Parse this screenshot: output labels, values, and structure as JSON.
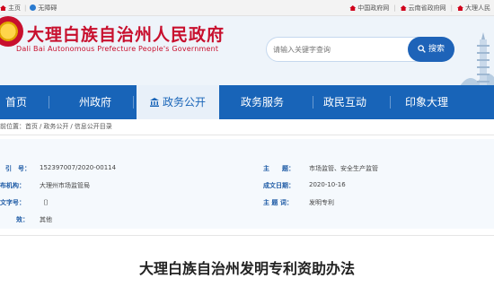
{
  "topbar": {
    "home_text": "主页",
    "accessibility_text": "无障碍",
    "links": [
      "中国政府网",
      "云南省政府网",
      "大理人民"
    ]
  },
  "header": {
    "site_title": "大理白族自治州人民政府",
    "site_subtitle": "Dali Bai Autonomous Prefecture People's Government",
    "search_placeholder": "请输入关键字查询",
    "search_button": "搜索"
  },
  "nav": {
    "items": [
      "首页",
      "州政府",
      "政务公开",
      "政务服务",
      "政民互动",
      "印象大理"
    ],
    "active_index": 2
  },
  "breadcrumb": {
    "prefix": "前位置：",
    "items": [
      "首页",
      "政务公开",
      "信息公开目录"
    ]
  },
  "info": {
    "left": [
      {
        "label": "引　号：",
        "value": "152397007/2020-00114"
      },
      {
        "label": "布机构：",
        "value": "大理州市场监管局"
      },
      {
        "label": "文字号：",
        "value": "〔〕"
      },
      {
        "label": "效：",
        "value": "其他"
      }
    ],
    "right": [
      {
        "label": "主　　题：",
        "value": "市场监管、安全生产监管"
      },
      {
        "label": "成文日期：",
        "value": "2020-10-16"
      },
      {
        "label": "主 题 词：",
        "value": "发明专利"
      }
    ]
  },
  "document": {
    "title": "大理白族自治州发明专利资助办法"
  },
  "colors": {
    "brand_red": "#c8102e",
    "nav_blue": "#1864b8",
    "label_blue": "#1d5aa5"
  }
}
